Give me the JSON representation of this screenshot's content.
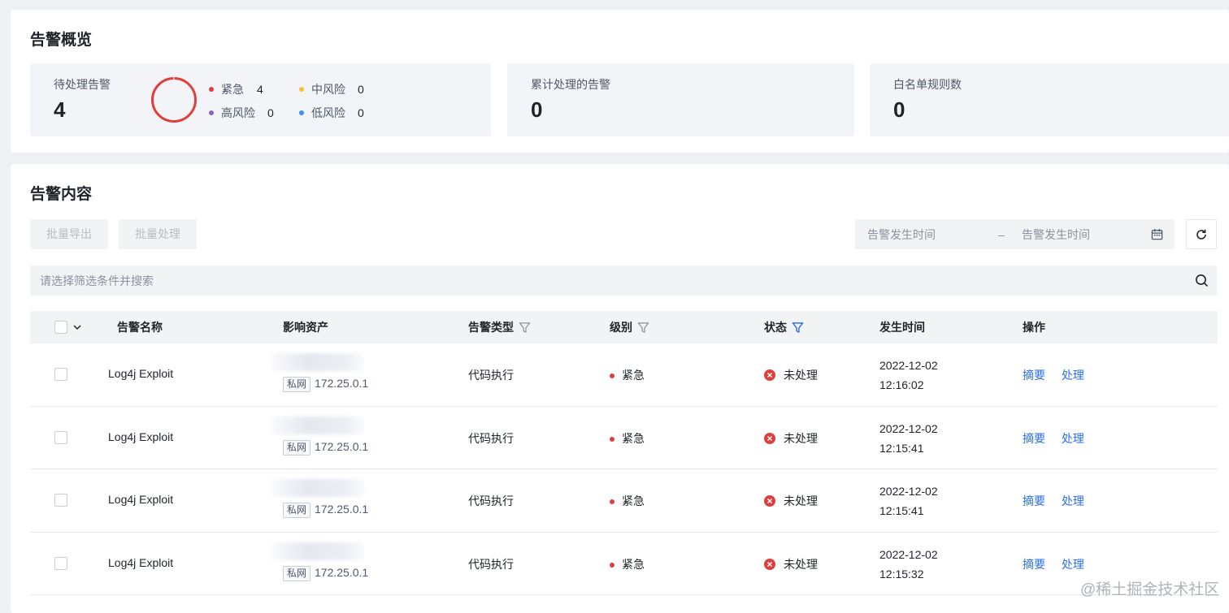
{
  "overview": {
    "title": "告警概览",
    "pending": {
      "label": "待处理告警",
      "value": "4",
      "legend": [
        {
          "label": "紧急",
          "count": "4",
          "color": "#e03d3d"
        },
        {
          "label": "中风险",
          "count": "0",
          "color": "#f2c12e"
        },
        {
          "label": "高风险",
          "count": "0",
          "color": "#8a63c4"
        },
        {
          "label": "低风险",
          "count": "0",
          "color": "#3f8ef2"
        }
      ]
    },
    "processed": {
      "label": "累计处理的告警",
      "value": "0"
    },
    "whitelist": {
      "label": "白名单规则数",
      "value": "0"
    }
  },
  "content": {
    "title": "告警内容",
    "toolbar": {
      "export_label": "批量导出",
      "process_label": "批量处理",
      "date_start_placeholder": "告警发生时间",
      "date_separator": "–",
      "date_end_placeholder": "告警发生时间"
    },
    "search": {
      "placeholder": "请选择筛选条件并搜索"
    },
    "columns": {
      "name": "告警名称",
      "asset": "影响资产",
      "type": "告警类型",
      "level": "级别",
      "status": "状态",
      "time": "发生时间",
      "action": "操作"
    },
    "rows": [
      {
        "name": "Log4j Exploit",
        "asset_tag": "私网",
        "asset_ip": "172.25.0.1",
        "type": "代码执行",
        "level": "紧急",
        "status": "未处理",
        "date": "2022-12-02",
        "time": "12:16:02",
        "summary": "摘要",
        "process": "处理"
      },
      {
        "name": "Log4j Exploit",
        "asset_tag": "私网",
        "asset_ip": "172.25.0.1",
        "type": "代码执行",
        "level": "紧急",
        "status": "未处理",
        "date": "2022-12-02",
        "time": "12:15:41",
        "summary": "摘要",
        "process": "处理"
      },
      {
        "name": "Log4j Exploit",
        "asset_tag": "私网",
        "asset_ip": "172.25.0.1",
        "type": "代码执行",
        "level": "紧急",
        "status": "未处理",
        "date": "2022-12-02",
        "time": "12:15:41",
        "summary": "摘要",
        "process": "处理"
      },
      {
        "name": "Log4j Exploit",
        "asset_tag": "私网",
        "asset_ip": "172.25.0.1",
        "type": "代码执行",
        "level": "紧急",
        "status": "未处理",
        "date": "2022-12-02",
        "time": "12:15:32",
        "summary": "摘要",
        "process": "处理"
      }
    ]
  },
  "watermark": "@稀土掘金技术社区",
  "colors": {
    "accent": "#2a6fe6",
    "urgent": "#e03d3d",
    "filter_active": "#2a6fe6",
    "filter_inactive": "#8a919f"
  }
}
